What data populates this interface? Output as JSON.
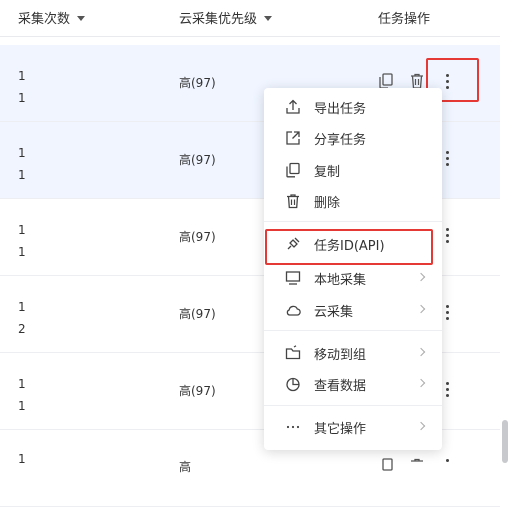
{
  "header": {
    "col_count": "采集次数",
    "col_priority": "云采集优先级",
    "col_ops": "任务操作"
  },
  "rows": [
    {
      "count_a": "1",
      "count_b": "1",
      "priority": "高(97)"
    },
    {
      "count_a": "1",
      "count_b": "1",
      "priority": "高(97)"
    },
    {
      "count_a": "1",
      "count_b": "1",
      "priority": "高(97)"
    },
    {
      "count_a": "1",
      "count_b": "2",
      "priority": "高(97)"
    },
    {
      "count_a": "1",
      "count_b": "1",
      "priority": "高(97)"
    },
    {
      "count_a": "1",
      "count_b": "",
      "priority": "高"
    }
  ],
  "menu": {
    "items": [
      {
        "label": "导出任务",
        "icon": "export-icon"
      },
      {
        "label": "分享任务",
        "icon": "share-icon"
      },
      {
        "label": "复制",
        "icon": "copy-icon"
      },
      {
        "label": "删除",
        "icon": "trash-icon"
      },
      {
        "label": "任务ID(API)",
        "icon": "plug-icon"
      },
      {
        "label": "本地采集",
        "icon": "monitor-icon"
      },
      {
        "label": "云采集",
        "icon": "cloud-icon"
      },
      {
        "label": "移动到组",
        "icon": "folder-move-icon"
      },
      {
        "label": "查看数据",
        "icon": "pie-chart-icon"
      },
      {
        "label": "其它操作",
        "icon": "ellipsis-icon"
      }
    ]
  },
  "colors": {
    "selected_row": "#f0f5ff",
    "highlight": "#e53935",
    "text": "#333333"
  }
}
